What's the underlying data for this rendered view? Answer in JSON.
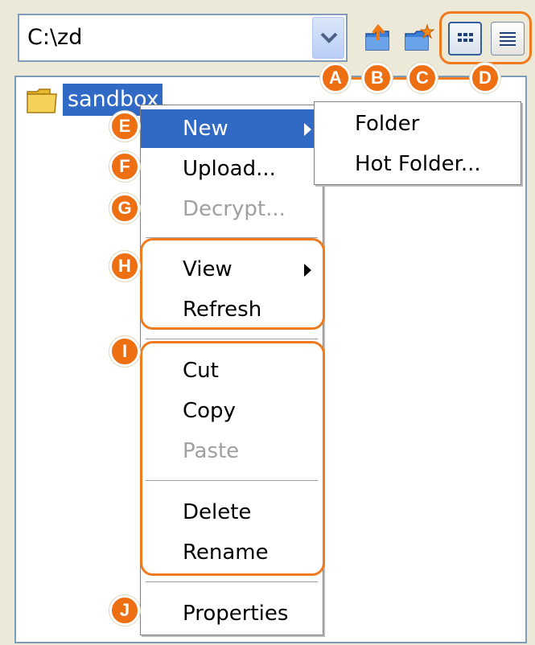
{
  "path": {
    "value": "C:\\zd"
  },
  "toolbar": {
    "dropdown_icon": "chevron-down-icon",
    "upload_icon": "folder-upload-icon",
    "new_folder_icon": "folder-new-icon",
    "icon_view_icon": "grid-view-icon",
    "list_view_icon": "list-view-icon"
  },
  "tree": {
    "items": [
      {
        "label": "sandbox",
        "selected": true
      }
    ]
  },
  "context_menu": {
    "items": [
      {
        "label": "New",
        "highlighted": true,
        "submenu": true
      },
      {
        "label": "Upload..."
      },
      {
        "label": "Decrypt...",
        "disabled": true
      },
      {
        "label": "View",
        "submenu": true
      },
      {
        "label": "Refresh"
      },
      {
        "label": "Cut"
      },
      {
        "label": "Copy"
      },
      {
        "label": "Paste",
        "disabled": true
      },
      {
        "label": "Delete"
      },
      {
        "label": "Rename"
      },
      {
        "label": "Properties"
      }
    ]
  },
  "submenu": {
    "items": [
      {
        "label": "Folder"
      },
      {
        "label": "Hot Folder..."
      }
    ]
  },
  "callouts": [
    "A",
    "B",
    "C",
    "D",
    "E",
    "F",
    "G",
    "H",
    "I",
    "J"
  ],
  "colors": {
    "accent": "#f07a1e",
    "badge": "#ee6e12",
    "selection": "#316ac5",
    "border": "#7f9db9"
  }
}
